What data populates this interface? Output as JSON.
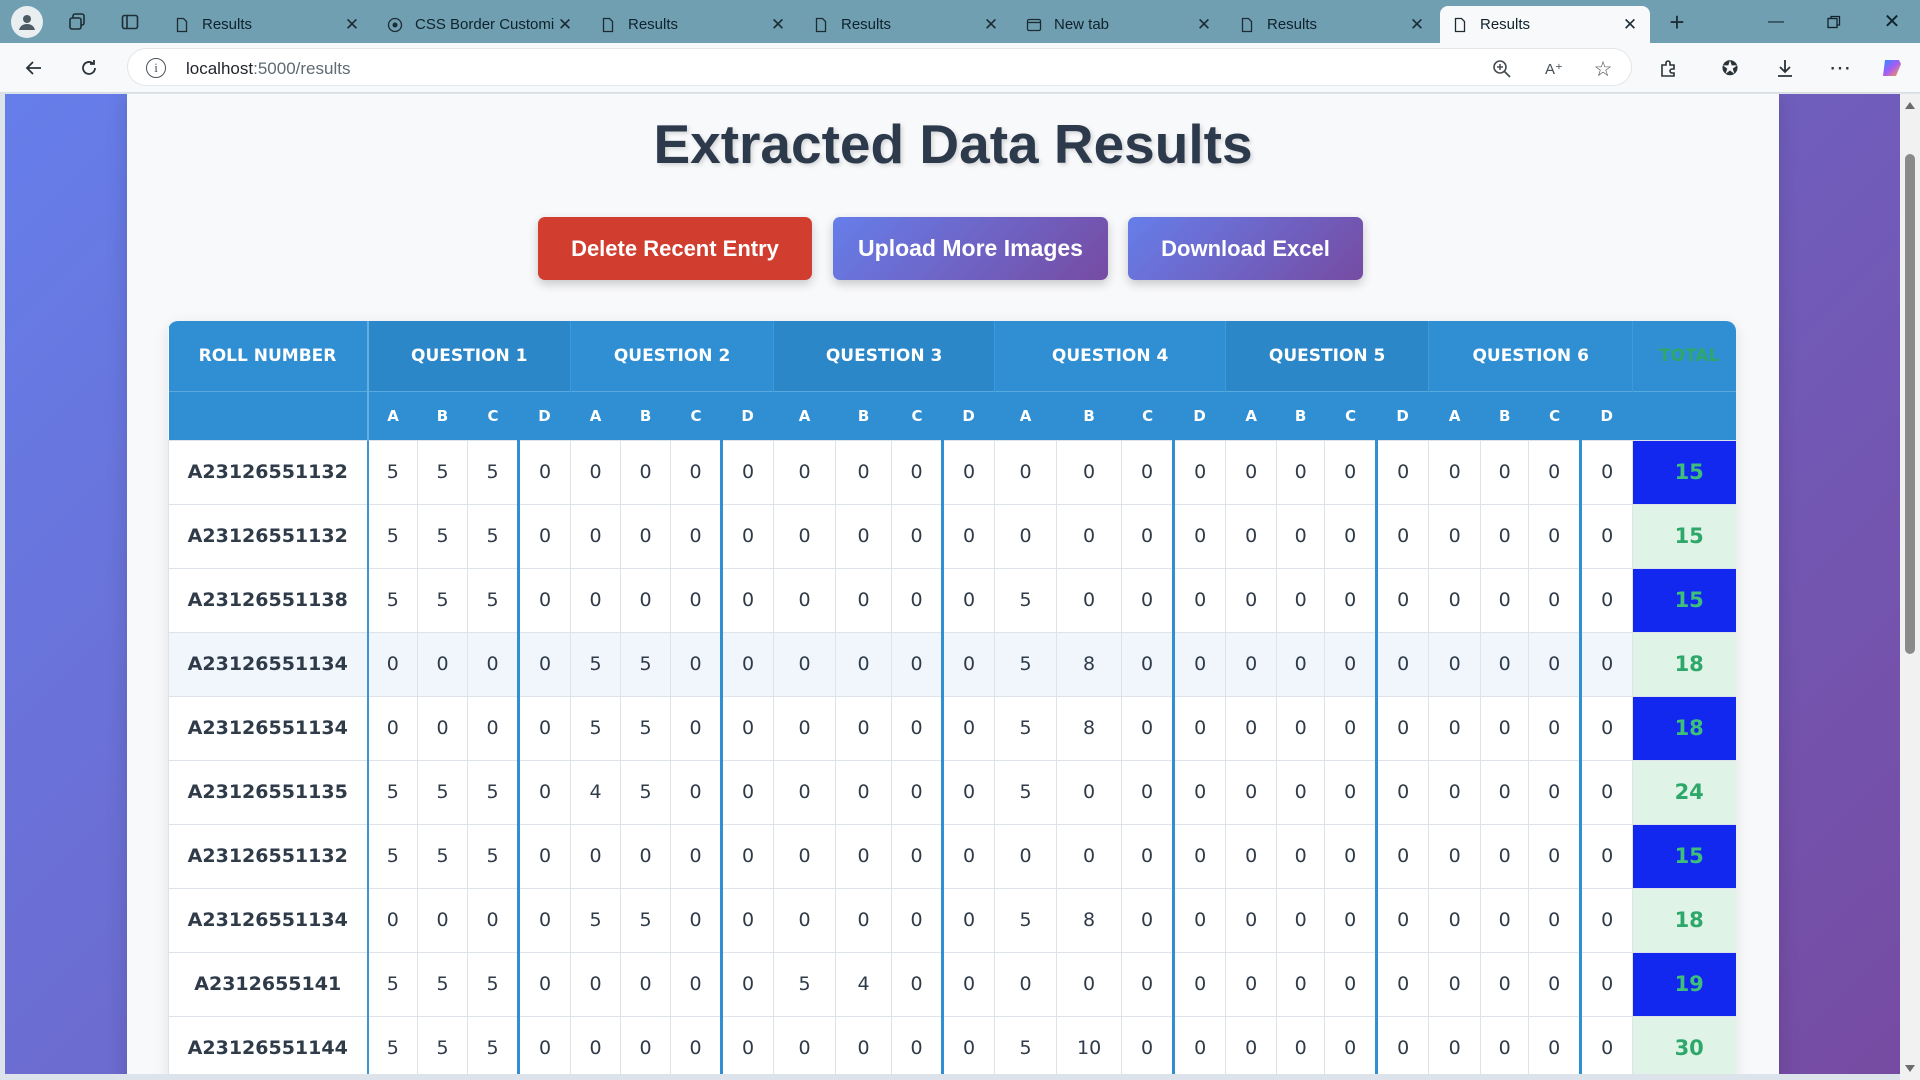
{
  "browser": {
    "tabs": [
      {
        "title": "Results",
        "active": false
      },
      {
        "title": "CSS Border Customiz",
        "active": false
      },
      {
        "title": "Results",
        "active": false
      },
      {
        "title": "Results",
        "active": false
      },
      {
        "title": "New tab",
        "active": false
      },
      {
        "title": "Results",
        "active": false
      },
      {
        "title": "Results",
        "active": true
      }
    ],
    "url_host": "localhost",
    "url_path": ":5000/results"
  },
  "page": {
    "title": "Extracted Data Results",
    "buttons": {
      "delete": "Delete Recent Entry",
      "upload": "Upload More Images",
      "download": "Download Excel"
    }
  },
  "table": {
    "roll_header": "Roll Number",
    "total_header": "Total",
    "questions": [
      "Question 1",
      "Question 2",
      "Question 3",
      "Question 4",
      "Question 5",
      "Question 6"
    ],
    "subcolumns": [
      "A",
      "B",
      "C",
      "D"
    ],
    "rows": [
      {
        "roll": "A23126551132",
        "scores": [
          5,
          5,
          5,
          0,
          0,
          0,
          0,
          0,
          0,
          0,
          0,
          0,
          0,
          0,
          0,
          0,
          0,
          0,
          0,
          0,
          0,
          0,
          0,
          0
        ],
        "total": "15"
      },
      {
        "roll": "A23126551132",
        "scores": [
          5,
          5,
          5,
          0,
          0,
          0,
          0,
          0,
          0,
          0,
          0,
          0,
          0,
          0,
          0,
          0,
          0,
          0,
          0,
          0,
          0,
          0,
          0,
          0
        ],
        "total": "15"
      },
      {
        "roll": "A23126551138",
        "scores": [
          5,
          5,
          5,
          0,
          0,
          0,
          0,
          0,
          0,
          0,
          0,
          0,
          5,
          0,
          0,
          0,
          0,
          0,
          0,
          0,
          0,
          0,
          0,
          0
        ],
        "total": "15"
      },
      {
        "roll": "A23126551134",
        "scores": [
          0,
          0,
          0,
          0,
          5,
          5,
          0,
          0,
          0,
          0,
          0,
          0,
          5,
          8,
          0,
          0,
          0,
          0,
          0,
          0,
          0,
          0,
          0,
          0
        ],
        "total": "18"
      },
      {
        "roll": "A23126551134",
        "scores": [
          0,
          0,
          0,
          0,
          5,
          5,
          0,
          0,
          0,
          0,
          0,
          0,
          5,
          8,
          0,
          0,
          0,
          0,
          0,
          0,
          0,
          0,
          0,
          0
        ],
        "total": "18"
      },
      {
        "roll": "A23126551135",
        "scores": [
          5,
          5,
          5,
          0,
          4,
          5,
          0,
          0,
          0,
          0,
          0,
          0,
          5,
          0,
          0,
          0,
          0,
          0,
          0,
          0,
          0,
          0,
          0,
          0
        ],
        "total": "24"
      },
      {
        "roll": "A23126551132",
        "scores": [
          5,
          5,
          5,
          0,
          0,
          0,
          0,
          0,
          0,
          0,
          0,
          0,
          0,
          0,
          0,
          0,
          0,
          0,
          0,
          0,
          0,
          0,
          0,
          0
        ],
        "total": "15"
      },
      {
        "roll": "A23126551134",
        "scores": [
          0,
          0,
          0,
          0,
          5,
          5,
          0,
          0,
          0,
          0,
          0,
          0,
          5,
          8,
          0,
          0,
          0,
          0,
          0,
          0,
          0,
          0,
          0,
          0
        ],
        "total": "18"
      },
      {
        "roll": "A2312655141",
        "scores": [
          5,
          5,
          5,
          0,
          0,
          0,
          0,
          0,
          5,
          4,
          0,
          0,
          0,
          0,
          0,
          0,
          0,
          0,
          0,
          0,
          0,
          0,
          0,
          0
        ],
        "total": "19"
      },
      {
        "roll": "A23126551144",
        "scores": [
          5,
          5,
          5,
          0,
          0,
          0,
          0,
          0,
          0,
          0,
          0,
          0,
          5,
          10,
          0,
          0,
          0,
          0,
          0,
          0,
          0,
          0,
          0,
          0
        ],
        "total": "30"
      }
    ]
  },
  "colors": {
    "header": "#2f8fd2",
    "delete": "#d13d2e",
    "gradient_start": "#667eea",
    "gradient_end": "#764ba2",
    "total_highlight": "#1228ee",
    "total_text": "#2ea86a"
  }
}
